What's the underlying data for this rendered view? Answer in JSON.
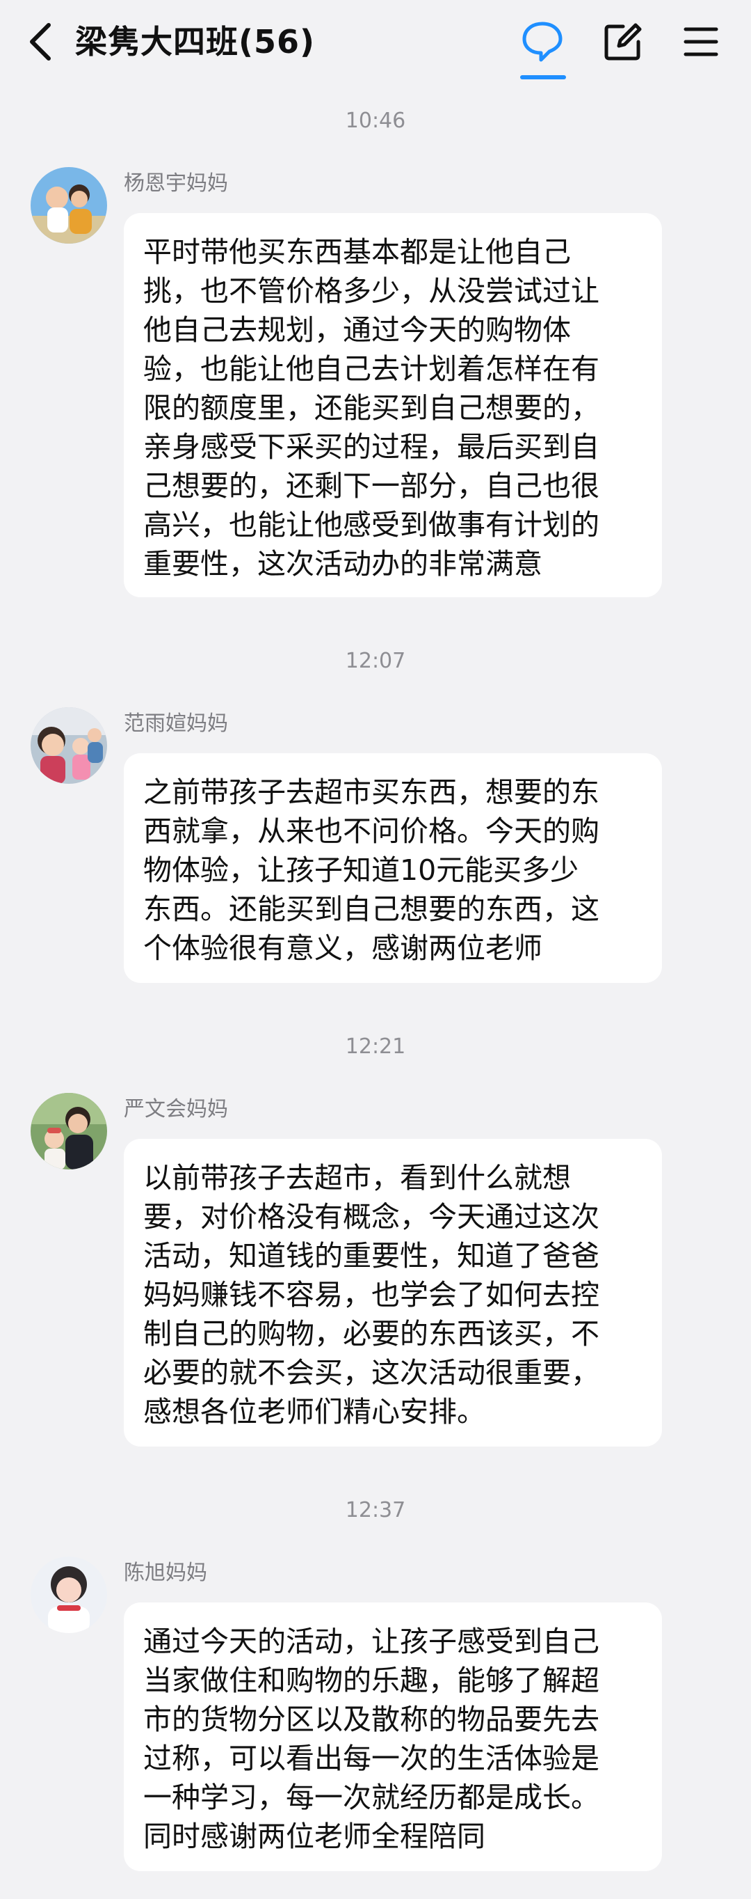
{
  "header": {
    "title": "梁隽大四班(56)",
    "back_icon": "chevron-left-icon",
    "chat_icon": "chat-bubble-icon",
    "edit_icon": "edit-icon",
    "menu_icon": "menu-icon",
    "accent_color": "#1f8fff"
  },
  "messages": [
    {
      "time": "10:46",
      "sender": "杨恩宇妈妈",
      "lines": [
        "平时带他买东西基本都是让他自己",
        "挑，也不管价格多少，从没尝试过让",
        "他自己去规划，通过今天的购物体",
        "验，也能让他自己去计划着怎样在有",
        "限的额度里，还能买到自己想要的，",
        "亲身感受下采买的过程，最后买到自",
        "己想要的，还剩下一部分，自己也很",
        "高兴，也能让他感受到做事有计划的",
        "重要性，这次活动办的非常满意"
      ]
    },
    {
      "time": "12:07",
      "sender": "范雨媗妈妈",
      "lines": [
        "之前带孩子去超市买东西，想要的东",
        "西就拿，从来也不问价格。今天的购",
        "物体验，让孩子知道10元能买多少",
        "东西。还能买到自己想要的东西，这",
        "个体验很有意义，感谢两位老师"
      ]
    },
    {
      "time": "12:21",
      "sender": "严文会妈妈",
      "lines": [
        "以前带孩子去超市，看到什么就想",
        "要，对价格没有概念，今天通过这次",
        "活动，知道钱的重要性，知道了爸爸",
        "妈妈赚钱不容易，也学会了如何去控",
        "制自己的购物，必要的东西该买，不",
        "必要的就不会买，这次活动很重要，",
        "感想各位老师们精心安排。"
      ]
    },
    {
      "time": "12:37",
      "sender": "陈旭妈妈",
      "lines": [
        "通过今天的活动，让孩子感受到自己",
        "当家做住和购物的乐趣，能够了解超",
        "市的货物分区以及散称的物品要先去",
        "过称，可以看出每一次的生活体验是",
        "一种学习，每一次就经历都是成长。",
        "同时感谢两位老师全程陪同"
      ]
    }
  ]
}
